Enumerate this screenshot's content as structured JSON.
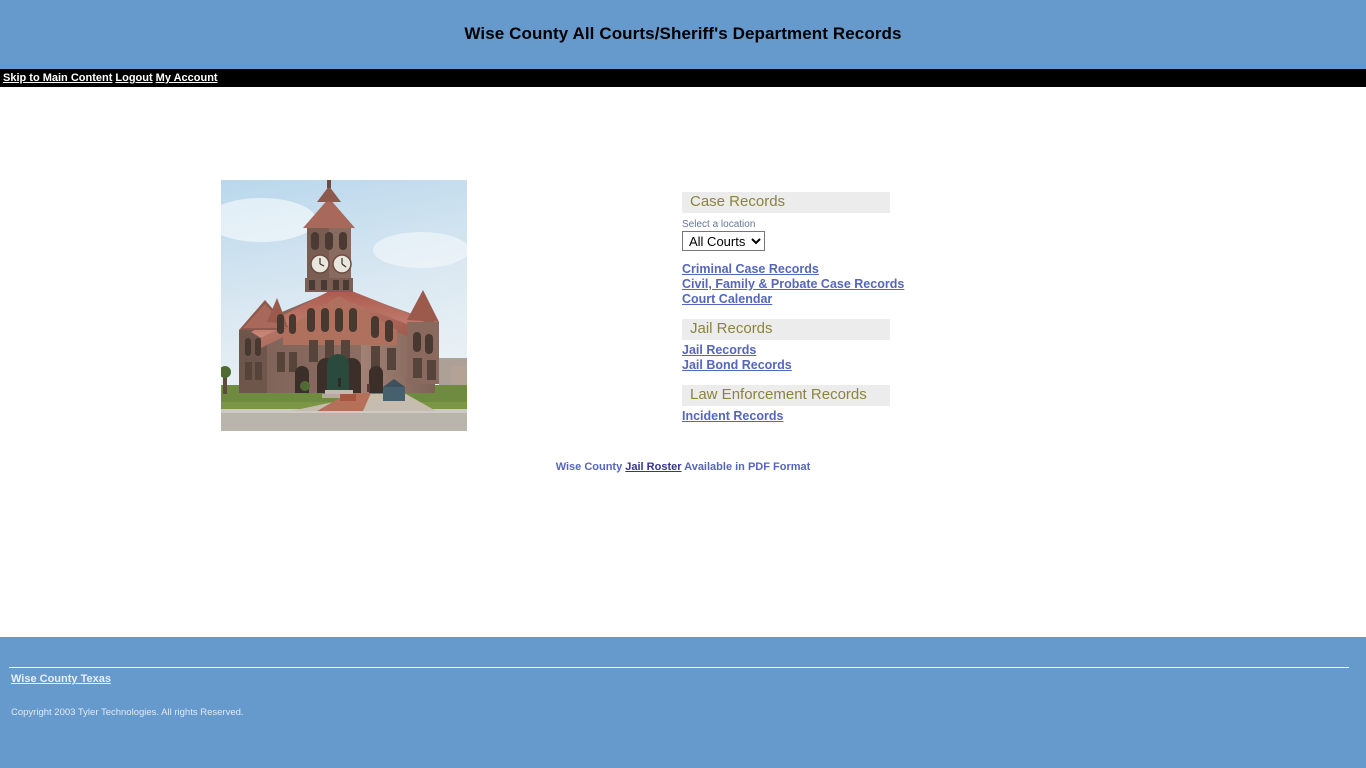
{
  "header": {
    "title": "Wise County All Courts/Sheriff's Department Records",
    "background_color": "#6699cc",
    "title_color": "#000000"
  },
  "navbar": {
    "background_color": "#000000",
    "links": [
      {
        "label": "Skip to Main Content",
        "name": "skip-to-main-content-link"
      },
      {
        "label": "Logout",
        "name": "logout-link"
      },
      {
        "label": "My Account",
        "name": "my-account-link"
      }
    ]
  },
  "main": {
    "photo": {
      "alt": "Wise County Courthouse",
      "name": "courthouse-photo"
    },
    "sections": [
      {
        "heading": "Case Records",
        "select": {
          "label": "Select a location",
          "value": "All Courts",
          "options": [
            "All Courts"
          ]
        },
        "links": [
          "Criminal Case Records",
          "Civil, Family & Probate Case Records",
          "Court Calendar"
        ]
      },
      {
        "heading": "Jail Records",
        "links": [
          "Jail Records",
          "Jail Bond Records"
        ]
      },
      {
        "heading": "Law Enforcement Records",
        "links": [
          "Incident Records"
        ]
      }
    ],
    "roster": {
      "prefix": "Wise County ",
      "link": "Jail Roster",
      "suffix": " Available in PDF Format"
    },
    "colors": {
      "section_heading_text": "#8a8340",
      "section_heading_bg": "#ececec",
      "link": "#5566bb",
      "select_label": "#667799"
    }
  },
  "footer": {
    "background_color": "#6699cc",
    "link": "Wise County Texas",
    "copyright": "Copyright 2003 Tyler Technologies. All rights Reserved."
  }
}
